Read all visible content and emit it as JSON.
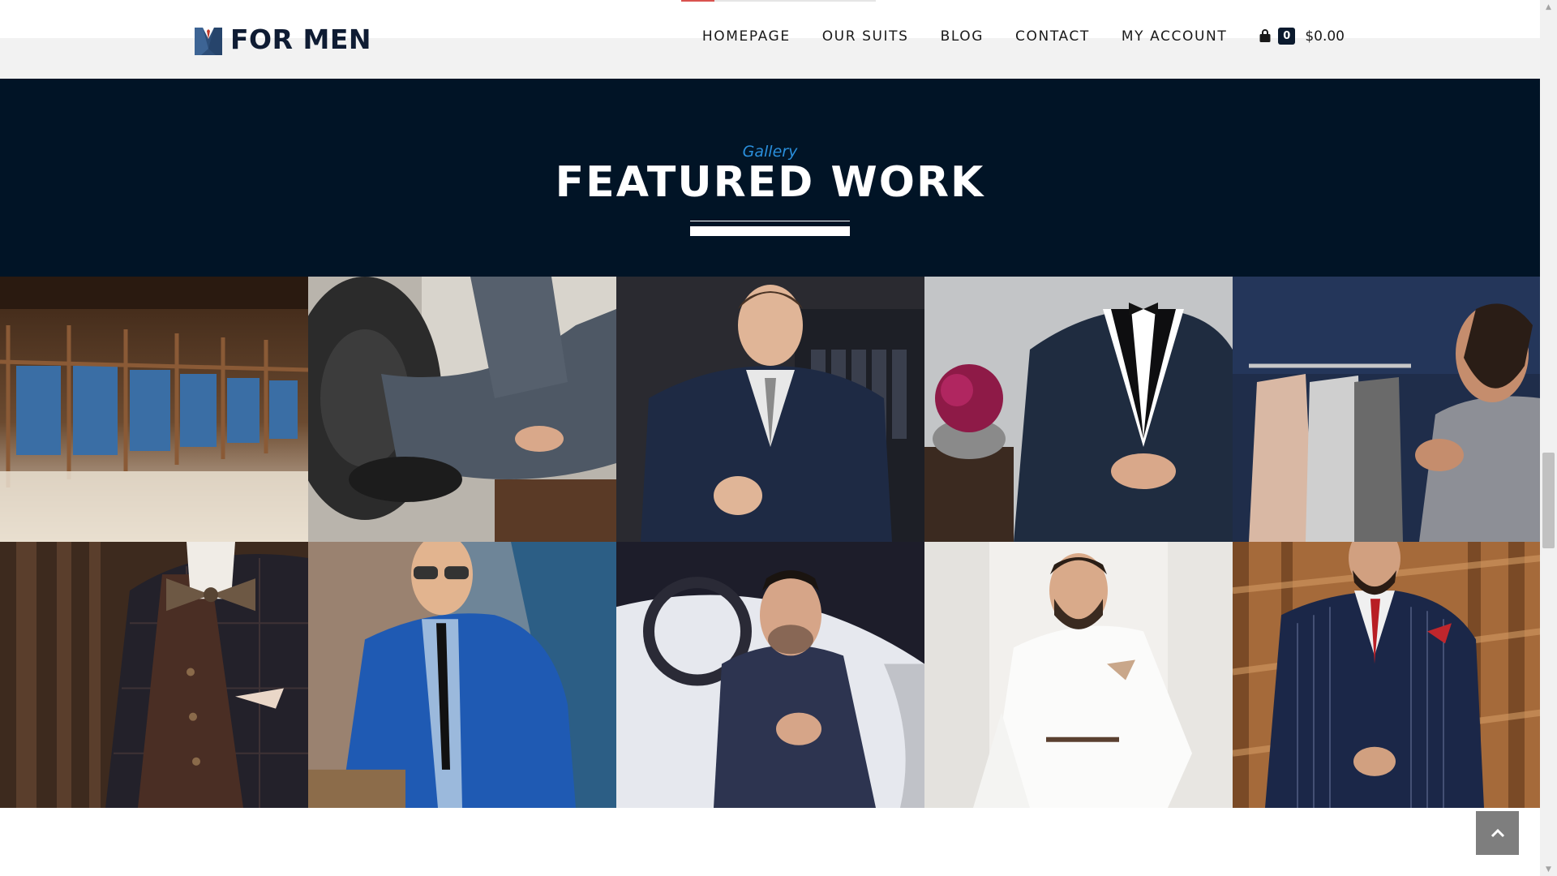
{
  "brand": {
    "name": "FOR MEN",
    "icon": "suit-jacket-icon"
  },
  "header": {
    "nav": [
      "HOMEPAGE",
      "OUR SUITS",
      "BLOG",
      "CONTACT",
      "MY ACCOUNT"
    ],
    "cart": {
      "icon": "shopping-bag-icon",
      "count": "0",
      "total": "$0.00"
    },
    "scroll_progress": 0.17
  },
  "section": {
    "eyebrow": "Gallery",
    "title": "FEATURED WORK"
  },
  "gallery": {
    "items": [
      "suit-store-interior",
      "man-seated-grey-check-suit",
      "young-man-navy-three-piece",
      "man-black-tuxedo-bow-tie",
      "bearded-man-clothing-rack",
      "plaid-suit-bow-tie-closeup",
      "man-blue-suit-sunglasses-car",
      "man-navy-suit-in-car",
      "man-white-suit-seated",
      "man-pinstripe-double-breasted"
    ]
  },
  "colors": {
    "navy": "#011426",
    "accent_blue": "#2a8fdc",
    "accent_red": "#d9534f"
  },
  "back_to_top": {
    "icon": "chevron-up-icon"
  }
}
